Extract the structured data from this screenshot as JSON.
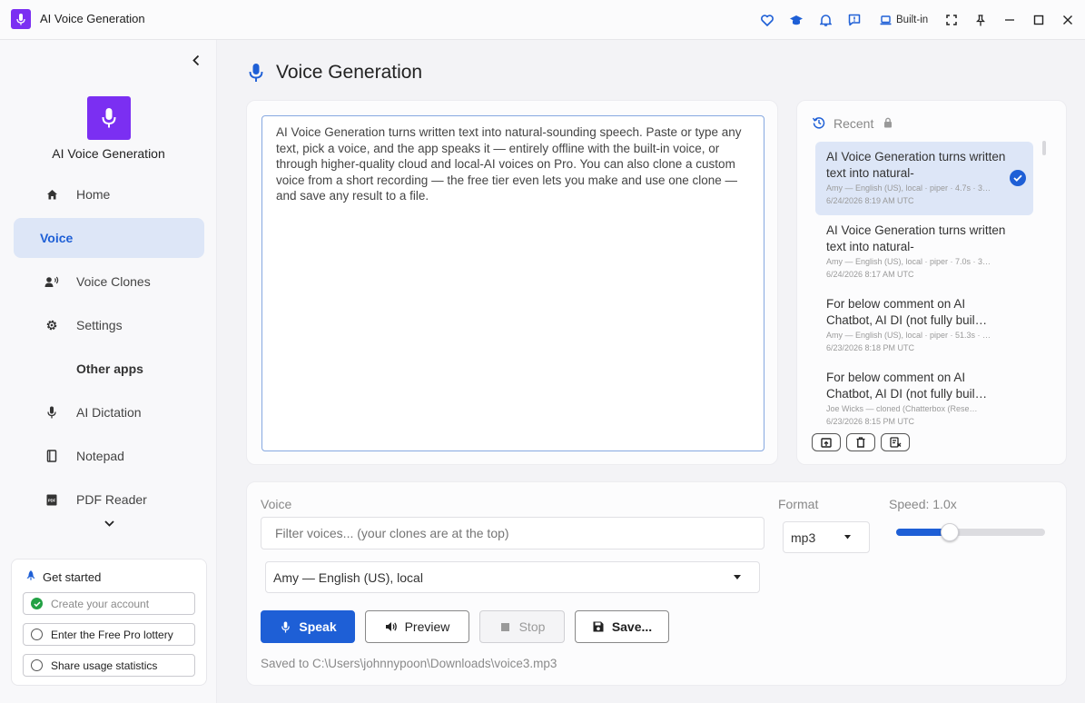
{
  "window": {
    "title": "AI Voice Generation",
    "builtin_label": "Built-in",
    "icons": [
      "heart-icon",
      "graduation-cap-icon",
      "bell-icon",
      "feedback-icon",
      "laptop-icon",
      "fullscreen-icon",
      "pin-icon",
      "minimize-icon",
      "maximize-icon",
      "close-icon"
    ]
  },
  "colors": {
    "accent": "#1e5fd6",
    "brand": "#7b2ff2",
    "active_nav_bg": "#dde6f7",
    "success": "#22a144"
  },
  "sidebar": {
    "brand_name": "AI Voice Generation",
    "items": [
      {
        "label": "Home",
        "icon": "home-icon"
      },
      {
        "label": "Voice",
        "icon": "",
        "active": true
      },
      {
        "label": "Voice Clones",
        "icon": "voice-clone-icon"
      },
      {
        "label": "Settings",
        "icon": "gear-icon"
      }
    ],
    "other_apps_label": "Other apps",
    "other_apps": [
      {
        "label": "AI Dictation",
        "icon": "microphone-icon"
      },
      {
        "label": "Notepad",
        "icon": "notepad-icon"
      },
      {
        "label": "PDF Reader",
        "icon": "pdf-icon"
      }
    ],
    "get_started": {
      "title": "Get started",
      "items": [
        {
          "label": "Create your account",
          "done": true
        },
        {
          "label": "Enter the Free Pro lottery",
          "done": false
        },
        {
          "label": "Share usage statistics",
          "done": false
        }
      ]
    }
  },
  "main": {
    "page_title": "Voice Generation",
    "text_content": "AI Voice Generation turns written text into natural-sounding speech. Paste or type any text, pick a voice, and the app speaks it — entirely offline with the built-in voice, or through higher-quality cloud and local-AI voices on Pro. You can also clone a custom voice from a short recording — the free tier even lets you make and use one clone — and save any result to a file."
  },
  "recent": {
    "title": "Recent",
    "items": [
      {
        "title": "AI Voice Generation turns written text into natural-",
        "meta": "Amy — English (US), local · piper · 4.7s · 3…",
        "time": "6/24/2026 8:19 AM UTC",
        "selected": true
      },
      {
        "title": "AI Voice Generation turns written text into natural-",
        "meta": "Amy — English (US), local · piper · 7.0s · 3…",
        "time": "6/24/2026 8:17 AM UTC",
        "selected": false
      },
      {
        "title": "For below comment on AI Chatbot, AI DI (not fully buil…",
        "meta": "Amy — English (US), local · piper · 51.3s · …",
        "time": "6/23/2026 8:18 PM UTC",
        "selected": false
      },
      {
        "title": "For below comment on AI Chatbot, AI DI (not fully buil…",
        "meta": "Joe Wicks — cloned (Chatterbox (Rese…",
        "time": "6/23/2026 8:15 PM UTC",
        "selected": false
      }
    ],
    "actions": [
      "open-file-icon",
      "trash-icon",
      "clear-list-icon"
    ]
  },
  "controls": {
    "voice_label": "Voice",
    "filter_placeholder": "Filter voices... (your clones are at the top)",
    "voice_selected": "Amy — English (US), local",
    "format_label": "Format",
    "format_selected": "mp3",
    "speed_label": "Speed: 1.0x",
    "speed_fraction": 0.36,
    "buttons": {
      "speak": "Speak",
      "preview": "Preview",
      "stop": "Stop",
      "save": "Save..."
    },
    "status": "Saved to C:\\Users\\johnnypoon\\Downloads\\voice3.mp3"
  }
}
